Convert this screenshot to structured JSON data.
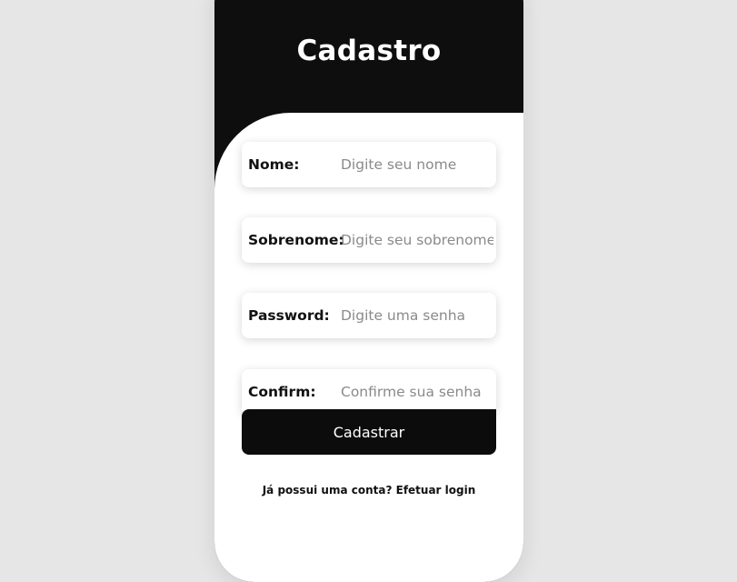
{
  "header": {
    "title": "Cadastro"
  },
  "form": {
    "fields": [
      {
        "label": "Nome:",
        "placeholder": "Digite seu nome"
      },
      {
        "label": "Sobrenome:",
        "placeholder": "Digite seu sobrenome"
      },
      {
        "label": "Password:",
        "placeholder": "Digite uma senha"
      },
      {
        "label": "Confirm:",
        "placeholder": "Confirme sua senha"
      }
    ],
    "submit_label": "Cadastrar"
  },
  "footer": {
    "question": "Já possui uma conta?",
    "link_label": "Efetuar login"
  },
  "colors": {
    "page_background": "#e6e6e6",
    "header_background": "#0e0e0e",
    "form_background": "#ffffff",
    "button_background": "#0c0c0c"
  }
}
